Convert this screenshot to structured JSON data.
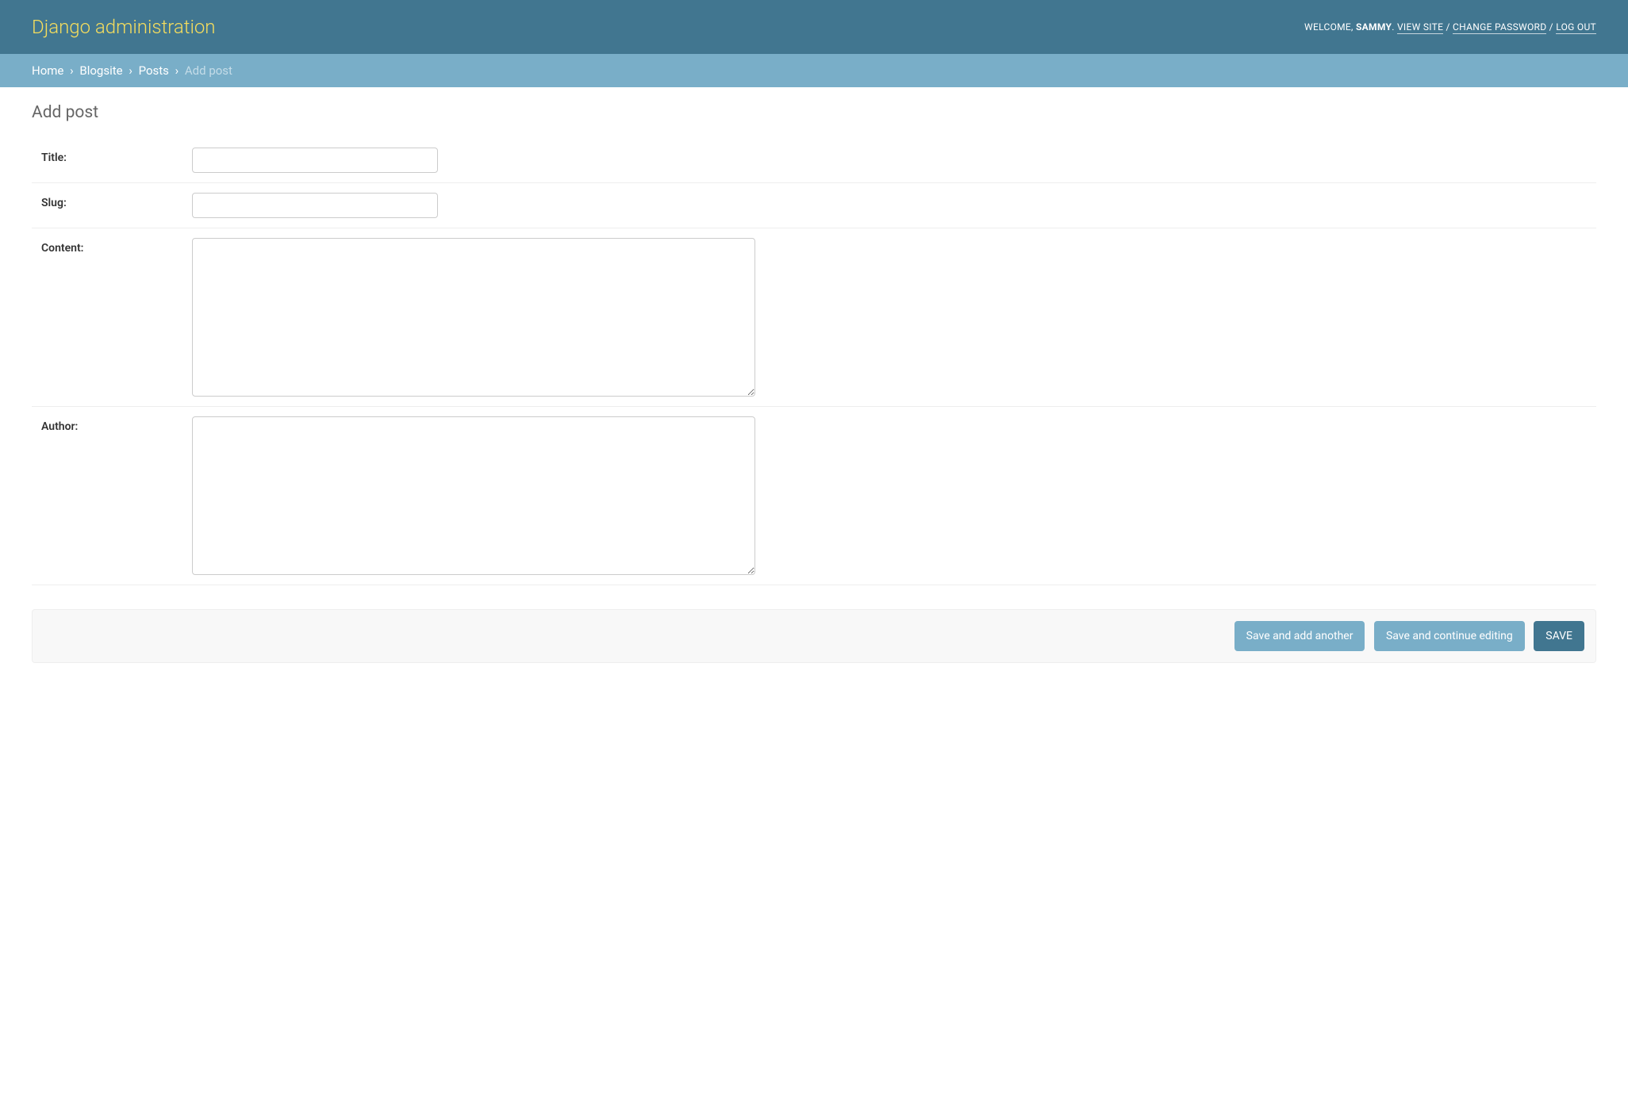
{
  "header": {
    "branding": "Django administration",
    "welcome_prefix": "WELCOME, ",
    "username": "SAMMY",
    "period": ". ",
    "view_site": "VIEW SITE",
    "sep": " / ",
    "change_password": "CHANGE PASSWORD",
    "log_out": "LOG OUT"
  },
  "breadcrumbs": {
    "home": "Home",
    "app": "Blogsite",
    "model": "Posts",
    "current": "Add post",
    "sep": "›"
  },
  "page": {
    "title": "Add post"
  },
  "form": {
    "title_label": "Title:",
    "slug_label": "Slug:",
    "content_label": "Content:",
    "author_label": "Author:",
    "title_value": "",
    "slug_value": "",
    "content_value": "",
    "author_value": ""
  },
  "actions": {
    "save_add_another": "Save and add another",
    "save_continue": "Save and continue editing",
    "save": "SAVE"
  }
}
